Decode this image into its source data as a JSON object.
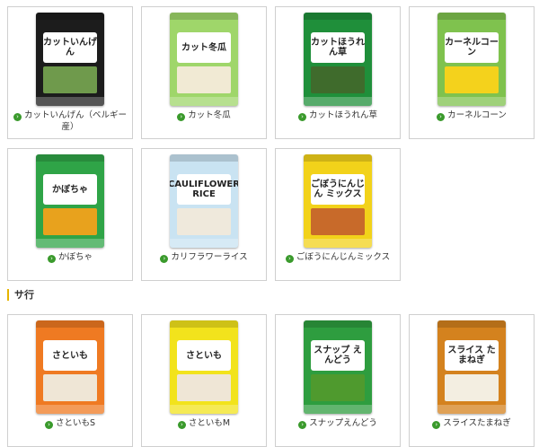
{
  "products_top": [
    {
      "label": "カットいんげん（ベルギー産）",
      "pkg_text": "カットいんげん",
      "pkg_color": "#1c1c1c",
      "window_color": "#6f9a4c"
    },
    {
      "label": "カット冬瓜",
      "pkg_text": "カット冬瓜",
      "pkg_color": "#9fd66a",
      "window_color": "#f1ead4"
    },
    {
      "label": "カットほうれん草",
      "pkg_text": "カットほうれん草",
      "pkg_color": "#1f8f3a",
      "window_color": "#3f6b2c"
    },
    {
      "label": "カーネルコーン",
      "pkg_text": "カーネルコーン",
      "pkg_color": "#7fc24e",
      "window_color": "#f4d21c"
    },
    {
      "label": "かぼちゃ",
      "pkg_text": "かぼちゃ",
      "pkg_color": "#2fa447",
      "window_color": "#e8a21d"
    },
    {
      "label": "カリフラワーライス",
      "pkg_text": "CAULIFLOWER RICE",
      "pkg_color": "#c9e3f2",
      "window_color": "#efe9dc"
    },
    {
      "label": "ごぼうにんじんミックス",
      "pkg_text": "ごぼうにんじん ミックス",
      "pkg_color": "#f2d21a",
      "window_color": "#c86a2a"
    }
  ],
  "section": {
    "heading": "サ行"
  },
  "products_sa": [
    {
      "label": "さといもS",
      "pkg_text": "さといも",
      "pkg_color": "#ef7a22",
      "window_color": "#efe6d6"
    },
    {
      "label": "さといもM",
      "pkg_text": "さといも",
      "pkg_color": "#f2e31c",
      "window_color": "#efe6d6"
    },
    {
      "label": "スナップえんどう",
      "pkg_text": "スナップ えんどう",
      "pkg_color": "#2e9d3f",
      "window_color": "#4f9a2e"
    },
    {
      "label": "スライスたまねぎ",
      "pkg_text": "スライス たまねぎ",
      "pkg_color": "#d4821e",
      "window_color": "#f3eee1"
    }
  ],
  "ui": {
    "arrow_glyph": "›"
  }
}
